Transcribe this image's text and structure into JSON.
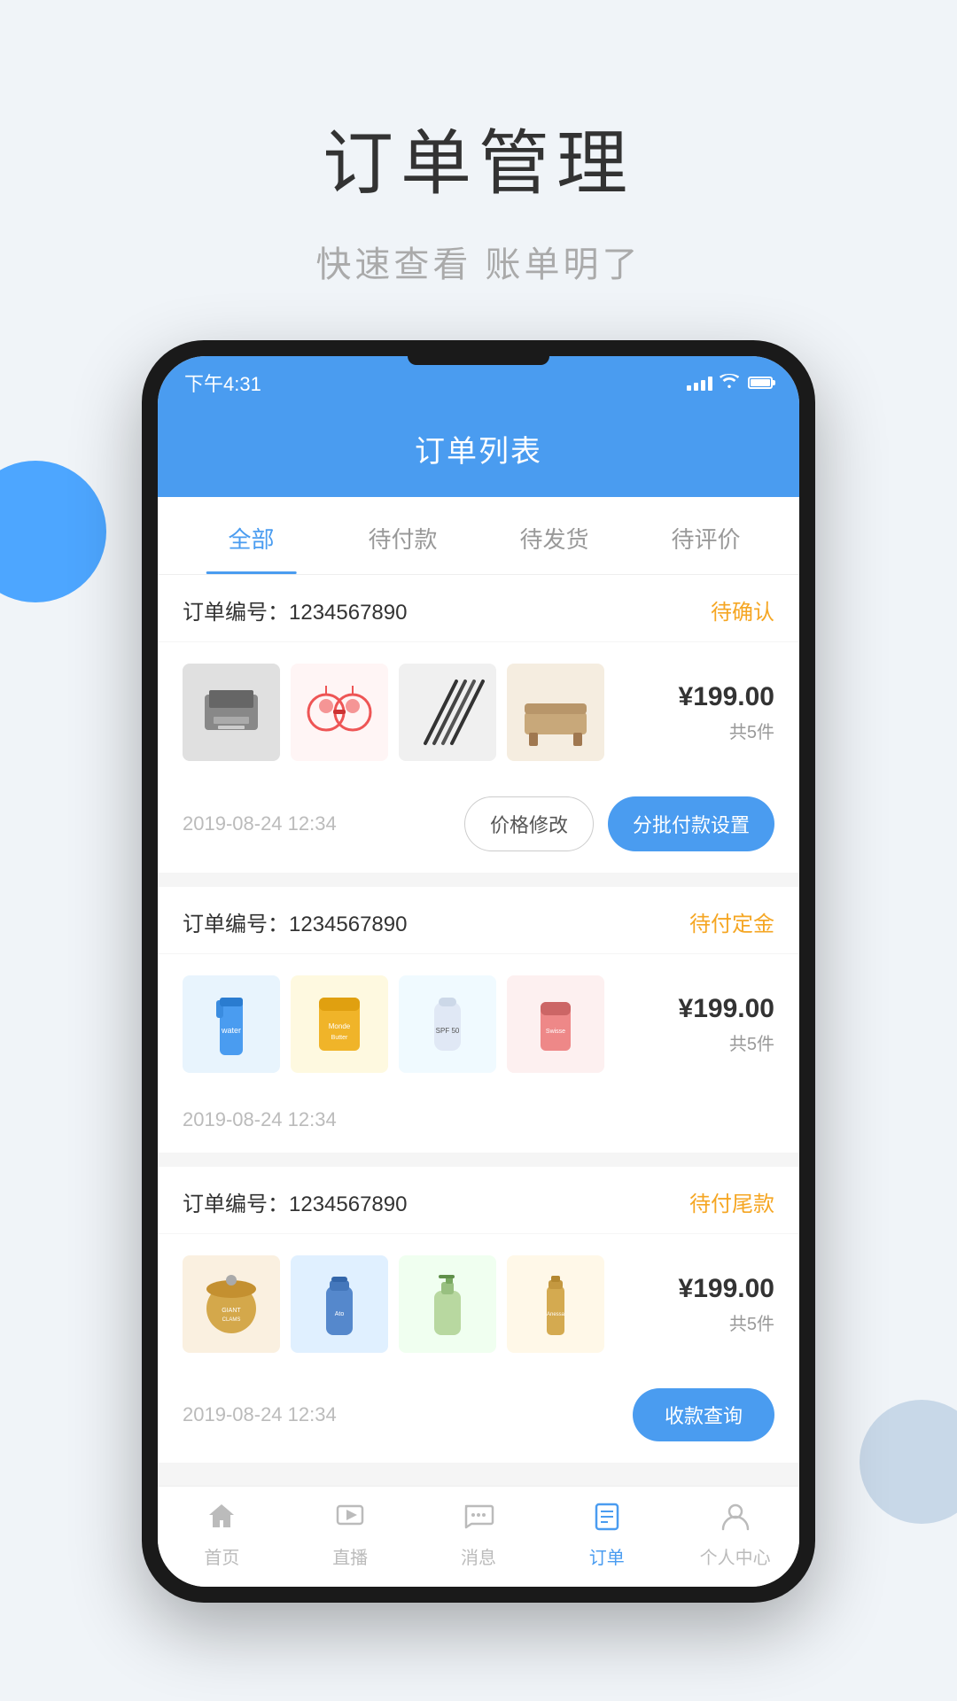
{
  "page": {
    "title": "订单管理",
    "subtitle": "快速查看 账单明了"
  },
  "status_bar": {
    "time": "下午4:31"
  },
  "app": {
    "header_title": "订单列表"
  },
  "tabs": [
    {
      "label": "全部",
      "active": true
    },
    {
      "label": "待付款",
      "active": false
    },
    {
      "label": "待发货",
      "active": false
    },
    {
      "label": "待评价",
      "active": false
    }
  ],
  "orders": [
    {
      "id": "order-1",
      "number_label": "订单编号：",
      "number": "1234567890",
      "status": "待确认",
      "price": "¥199.00",
      "count": "共5件",
      "date": "2019-08-24 12:34",
      "actions": [
        "价格修改",
        "分批付款设置"
      ],
      "items": [
        {
          "type": "printer",
          "bg": "#e8e8e8"
        },
        {
          "type": "decor",
          "bg": "#fef2f2"
        },
        {
          "type": "rods",
          "bg": "#f0f0f0"
        },
        {
          "type": "furniture",
          "bg": "#f5ede0"
        }
      ]
    },
    {
      "id": "order-2",
      "number_label": "订单编号：",
      "number": "1234567890",
      "status": "待付定金",
      "price": "¥199.00",
      "count": "共5件",
      "date": "2019-08-24 12:34",
      "actions": [],
      "items": [
        {
          "type": "drink",
          "bg": "#e8f4fd"
        },
        {
          "type": "snack",
          "bg": "#fef9e0"
        },
        {
          "type": "sunscreen",
          "bg": "#f0faff"
        },
        {
          "type": "supplement",
          "bg": "#fdf0f0"
        }
      ]
    },
    {
      "id": "order-3",
      "number_label": "订单编号：",
      "number": "1234567890",
      "status": "待付尾款",
      "price": "¥199.00",
      "count": "共5件",
      "date": "2019-08-24 12:34",
      "actions": [
        "收款查询"
      ],
      "items": [
        {
          "type": "food",
          "bg": "#faf0e0"
        },
        {
          "type": "bottle",
          "bg": "#e0f0ff"
        },
        {
          "type": "lotion",
          "bg": "#f0fff0"
        },
        {
          "type": "serum",
          "bg": "#fff8e8"
        }
      ]
    }
  ],
  "bottom_nav": [
    {
      "label": "首页",
      "icon": "home",
      "active": false
    },
    {
      "label": "直播",
      "icon": "live",
      "active": false
    },
    {
      "label": "消息",
      "icon": "message",
      "active": false
    },
    {
      "label": "订单",
      "icon": "order",
      "active": true
    },
    {
      "label": "个人中心",
      "icon": "profile",
      "active": false
    }
  ]
}
